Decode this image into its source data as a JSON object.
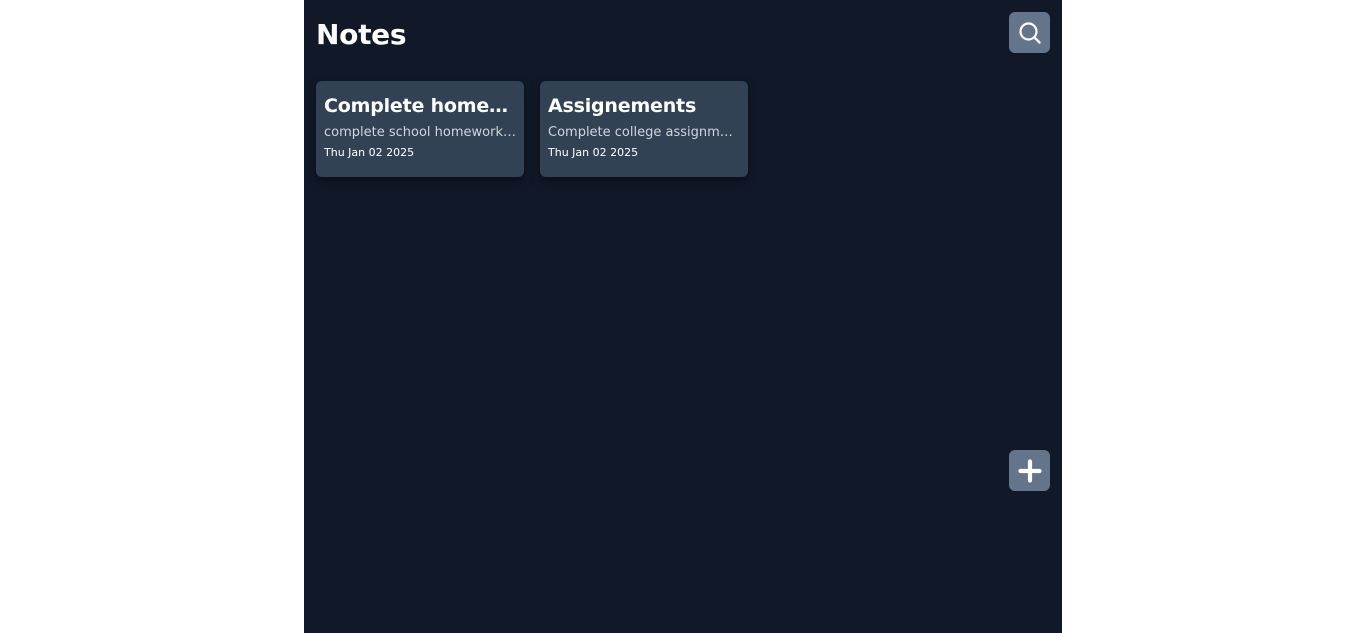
{
  "header": {
    "title": "Notes",
    "search_icon": "search-icon"
  },
  "notes": [
    {
      "title": "Complete homework",
      "body": "complete school homework before the deadline",
      "date": "Thu Jan 02 2025"
    },
    {
      "title": "Assignements",
      "body": "Complete college assignments",
      "date": "Thu Jan 02 2025"
    }
  ],
  "actions": {
    "add_icon": "plus-icon"
  },
  "colors": {
    "background": "#111827",
    "card": "#334155",
    "button": "#64748b",
    "text": "#ffffff",
    "muted_text": "#d1d5db"
  }
}
